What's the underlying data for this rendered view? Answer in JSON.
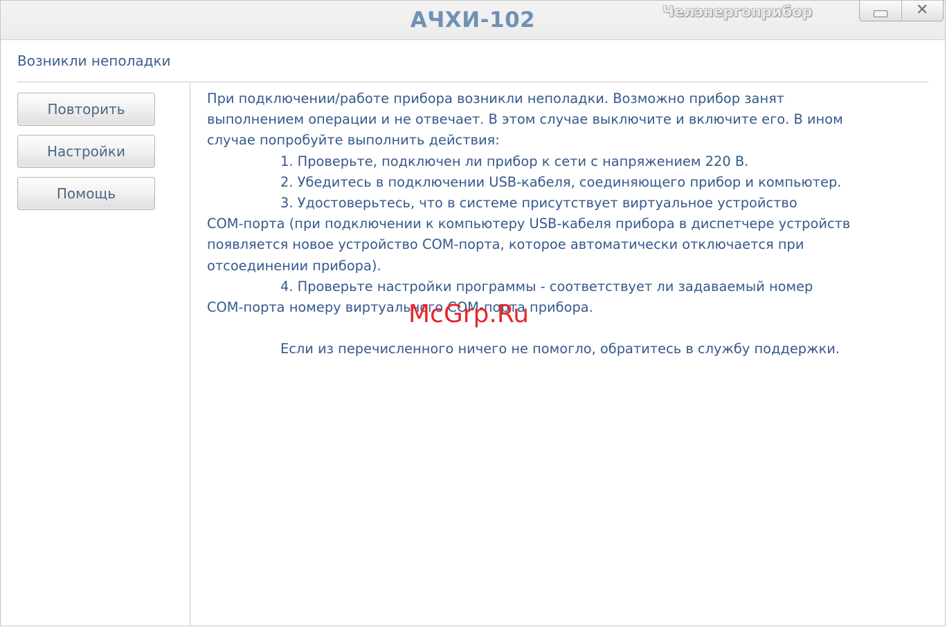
{
  "window": {
    "title": "АЧХИ-102",
    "brand": "Челэнергоприбор",
    "controls": {
      "minimize_icon": "minimize-icon",
      "close_glyph": "✕"
    }
  },
  "header": {
    "status": "Возникли неполадки"
  },
  "sidebar": {
    "buttons": [
      {
        "label": "Повторить"
      },
      {
        "label": "Настройки"
      },
      {
        "label": "Помощь"
      }
    ]
  },
  "message": {
    "lines": [
      "При подключении/работе прибора возникли неполадки. Возможно прибор занят",
      "выполнением операции и не отвечает. В этом случае выключите и включите его. В ином",
      "случае попробуйте выполнить действия:",
      "1. Проверьте, подключен ли прибор к сети с напряжением 220 В.",
      "2. Убедитесь в подключении USB-кабеля, соединяющего прибор и компьютер.",
      "3. Удостоверьтесь, что в системе присутствует виртуальное устройство",
      "COM-порта (при подключении к компьютеру USB-кабеля прибора в диспетчере устройств",
      "появляется новое устройство COM-порта, которое автоматически отключается при",
      "отсоединении прибора).",
      "4. Проверьте настройки программы - соответствует ли задаваемый номер",
      "COM-порта номеру виртуального COM-порта прибора.",
      "",
      "Если из перечисленного ничего не помогло, обратитесь в службу поддержки."
    ]
  },
  "watermark": "McGrp.Ru",
  "colors": {
    "title": "#6f91b5",
    "text": "#35598c",
    "watermark": "#e8262a"
  }
}
